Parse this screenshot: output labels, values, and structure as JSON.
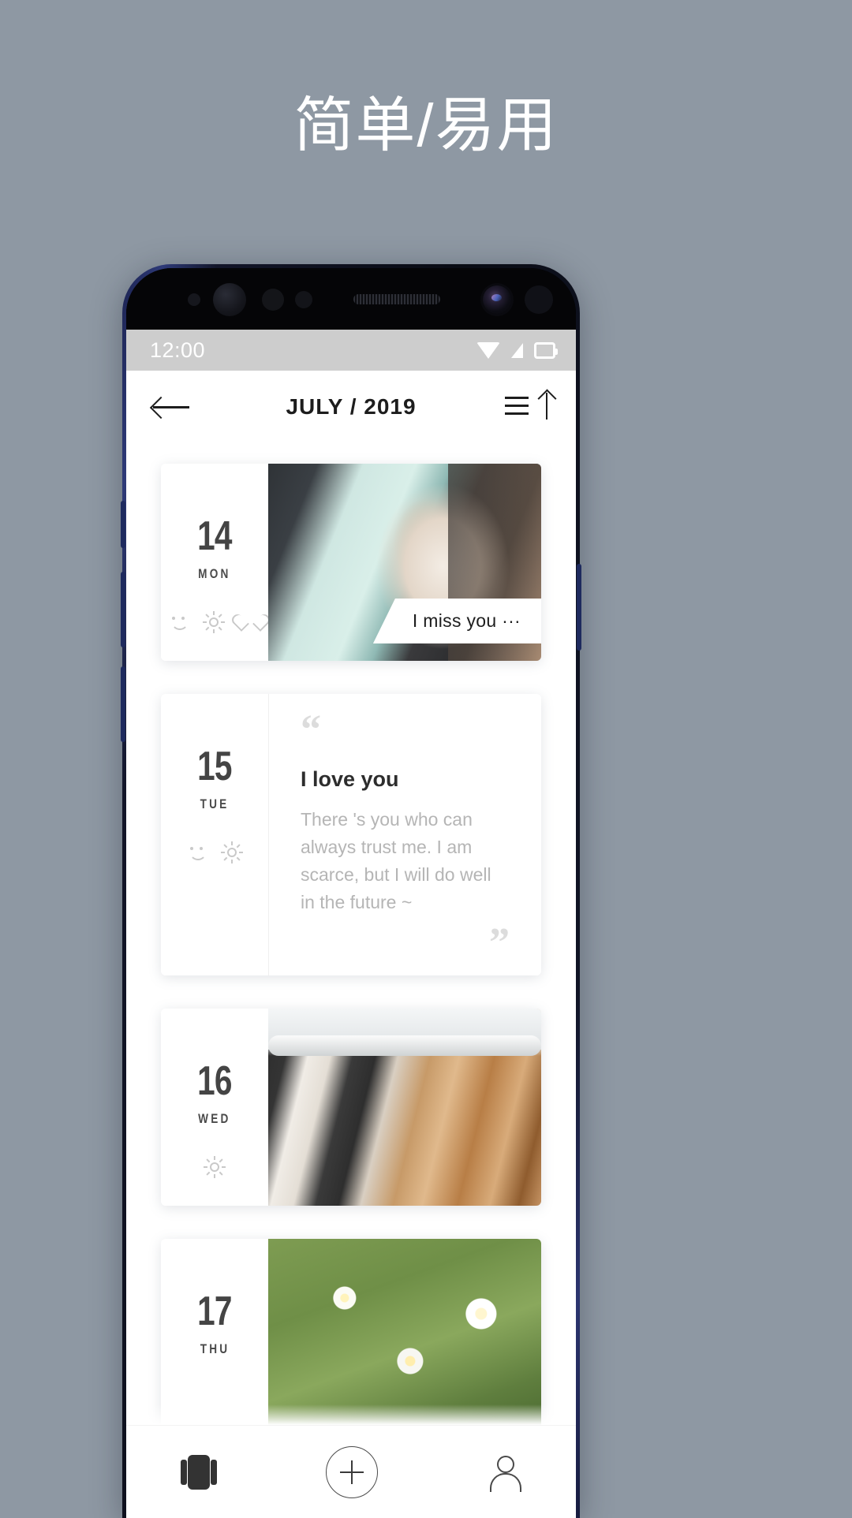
{
  "headline": "简单/易用",
  "status_bar": {
    "time": "12:00",
    "icons": [
      "wifi-icon",
      "signal-icon",
      "battery-icon"
    ]
  },
  "header": {
    "back_icon": "back-arrow-icon",
    "title": "JULY / 2019",
    "sort_icon": "sort-ascending-icon"
  },
  "cards": [
    {
      "day": "14",
      "weekday": "MON",
      "moods": [
        "smile-icon",
        "sun-icon",
        "heart-icon"
      ],
      "type": "photo",
      "photo": "cat-photo",
      "ribbon": "I miss you ···"
    },
    {
      "day": "15",
      "weekday": "TUE",
      "moods": [
        "smile-icon",
        "sun-icon"
      ],
      "type": "quote",
      "quote_open": "“",
      "quote_close": "”",
      "title": "I love you",
      "body": "There 's you who can always trust me. I am scarce, but I will do well in the future ~"
    },
    {
      "day": "16",
      "weekday": "WED",
      "moods": [
        "sun-icon"
      ],
      "type": "photo",
      "photo": "clothes-hangers-photo"
    },
    {
      "day": "17",
      "weekday": "THU",
      "moods": [],
      "type": "photo",
      "photo": "daisy-flowers-photo"
    }
  ],
  "bottom_nav": {
    "items": [
      "cards-stack-icon",
      "add-circle-icon",
      "profile-icon"
    ]
  },
  "colors": {
    "background": "#8e98a3",
    "headline_text": "#ffffff",
    "status_bar": "#cdcdcd",
    "card_bg": "#ffffff",
    "day_text": "#444444",
    "quote_title": "#2d2d2d",
    "quote_body": "#b5b5b5",
    "mood_icon": "#c9c9c9",
    "phone_edge": "#2e3a78"
  }
}
